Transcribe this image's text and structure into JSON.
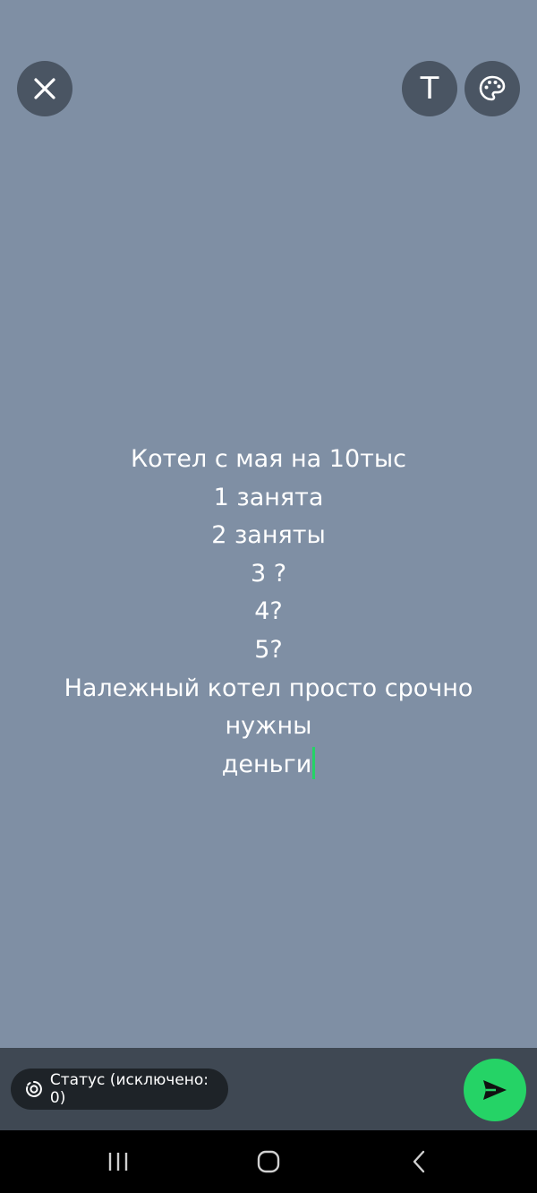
{
  "top_bar": {
    "close_icon": "close-icon",
    "text_tool_label": "T",
    "palette_icon": "palette-icon"
  },
  "status_text": {
    "lines": [
      "Котел с мая на 10тыс",
      "1 занята",
      "2 заняты",
      "3 ?",
      "4?",
      "5?",
      "Належный котел просто срочно нужны",
      "деньги"
    ],
    "caret_color": "#25d366"
  },
  "bottom_bar": {
    "privacy_label": "Статус (исключено: 0)",
    "privacy_icon": "status-privacy-icon",
    "send_icon": "send-icon",
    "send_color": "#25d366"
  },
  "nav_bar": {
    "recent_icon": "recent-apps-icon",
    "home_icon": "home-icon",
    "back_icon": "back-icon"
  },
  "colors": {
    "background": "#7f8fa4",
    "button_bg": "#4a5563",
    "bottom_bar_bg": "#3f4853"
  }
}
